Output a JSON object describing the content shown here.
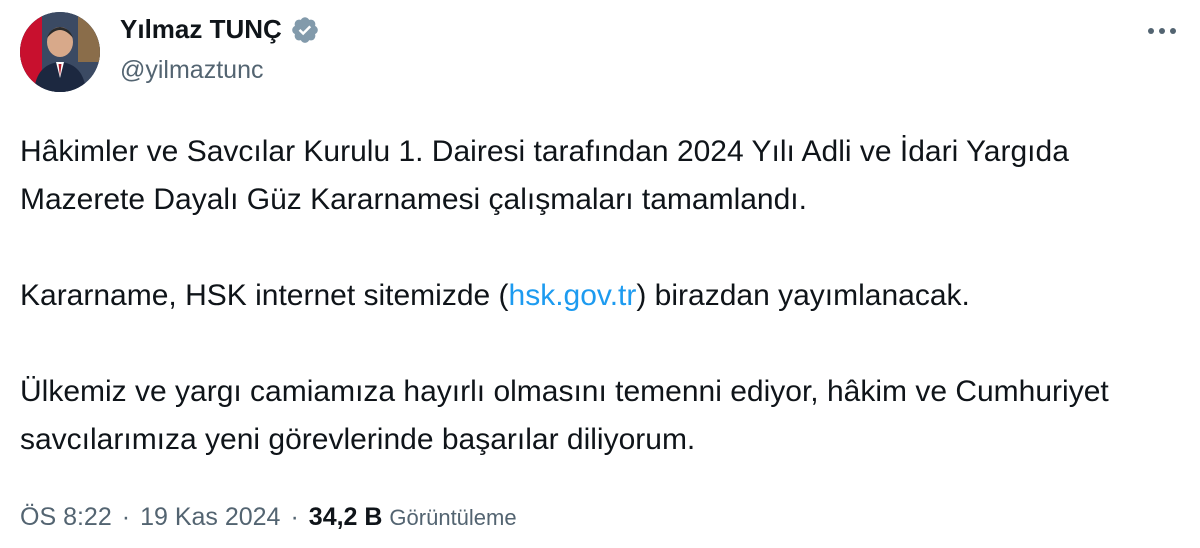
{
  "author": {
    "display_name": "Yılmaz TUNÇ",
    "handle": "@yilmaztunc",
    "verified_icon": "verified-badge-icon",
    "verified_color": "#829aab"
  },
  "tweet": {
    "p1": "Hâkimler ve Savcılar Kurulu 1. Dairesi tarafından 2024 Yılı Adli ve İdari Yargıda Mazerete Dayalı Güz Kararnamesi çalışmaları tamamlandı.",
    "p2_before": "Kararname, HSK internet sitemizde (",
    "p2_link": "hsk.gov.tr",
    "p2_after": ") birazdan yayımlanacak.",
    "p3": "Ülkemiz ve yargı camiamıza hayırlı olmasını temenni ediyor, hâkim ve Cumhuriyet savcılarımıza yeni görevlerinde başarılar diliyorum."
  },
  "meta": {
    "time": "ÖS 8:22",
    "separator": "·",
    "date": "19 Kas 2024",
    "views_count": "34,2 B",
    "views_label": "Görüntüleme"
  },
  "colors": {
    "link": "#1d9bf0",
    "text": "#0f1419",
    "secondary": "#536471"
  },
  "icons": {
    "more": "more-options-icon"
  }
}
